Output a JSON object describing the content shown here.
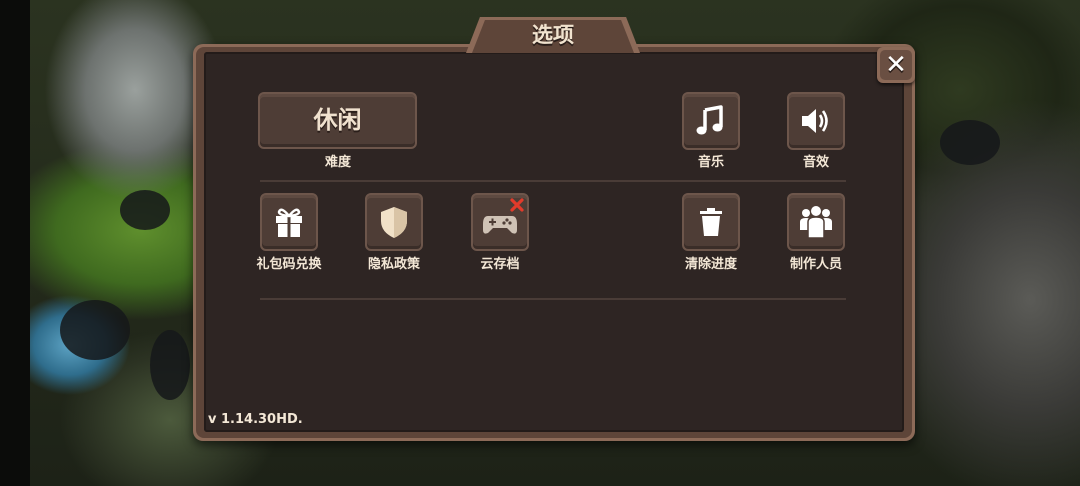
{
  "dialog": {
    "title": "选项",
    "close_icon": "close-icon"
  },
  "difficulty": {
    "value": "休闲",
    "label": "难度"
  },
  "audio": {
    "music_label": "音乐",
    "music_icon": "music-note-icon",
    "sound_label": "音效",
    "sound_icon": "speaker-icon"
  },
  "options": {
    "gift_label": "礼包码兑换",
    "gift_icon": "gift-icon",
    "privacy_label": "隐私政策",
    "privacy_icon": "shield-icon",
    "cloud_label": "云存档",
    "cloud_icon": "gamepad-icon",
    "cloud_status_icon": "red-x-icon",
    "clear_label": "清除进度",
    "clear_icon": "trash-icon",
    "credits_label": "制作人员",
    "credits_icon": "people-icon"
  },
  "version": "v 1.14.30HD.",
  "colors": {
    "panel_bg": "#2e2523",
    "frame": "#8c6a58",
    "button_bg": "#4e3d36",
    "text": "#f3e7d6",
    "cloud_x": "#e23b2b"
  }
}
